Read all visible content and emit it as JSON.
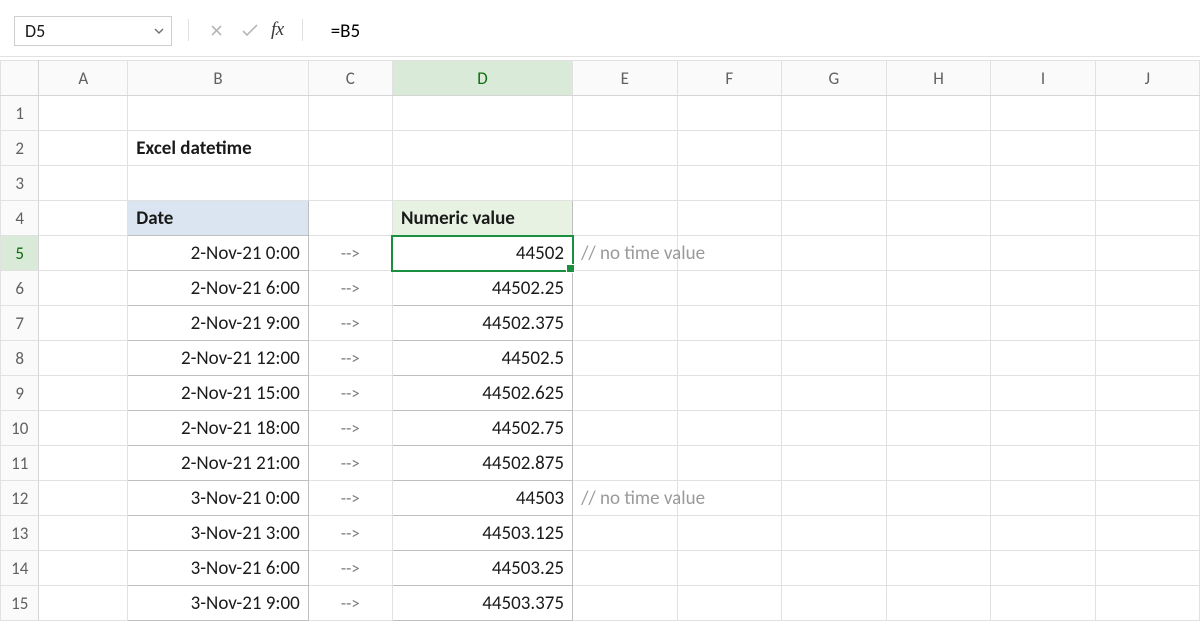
{
  "namebox": {
    "value": "D5"
  },
  "fxLabel": "fx",
  "formula": "=B5",
  "columns": [
    "A",
    "B",
    "C",
    "D",
    "E",
    "F",
    "G",
    "H",
    "I",
    "J"
  ],
  "rows": [
    "1",
    "2",
    "3",
    "4",
    "5",
    "6",
    "7",
    "8",
    "9",
    "10",
    "11",
    "12",
    "13",
    "14",
    "15"
  ],
  "title": "Excel datetime",
  "headers": {
    "date": "Date",
    "numeric": "Numeric value"
  },
  "arrow": "-->",
  "dataRows": [
    {
      "date": "2-Nov-21 0:00",
      "value": "44502",
      "note": "// no time value"
    },
    {
      "date": "2-Nov-21 6:00",
      "value": "44502.25",
      "note": ""
    },
    {
      "date": "2-Nov-21 9:00",
      "value": "44502.375",
      "note": ""
    },
    {
      "date": "2-Nov-21 12:00",
      "value": "44502.5",
      "note": ""
    },
    {
      "date": "2-Nov-21 15:00",
      "value": "44502.625",
      "note": ""
    },
    {
      "date": "2-Nov-21 18:00",
      "value": "44502.75",
      "note": ""
    },
    {
      "date": "2-Nov-21 21:00",
      "value": "44502.875",
      "note": ""
    },
    {
      "date": "3-Nov-21 0:00",
      "value": "44503",
      "note": "// no time value"
    },
    {
      "date": "3-Nov-21 3:00",
      "value": "44503.125",
      "note": ""
    },
    {
      "date": "3-Nov-21 6:00",
      "value": "44503.25",
      "note": ""
    },
    {
      "date": "3-Nov-21 9:00",
      "value": "44503.375",
      "note": ""
    }
  ],
  "activeRow": "5",
  "activeCol": "D"
}
